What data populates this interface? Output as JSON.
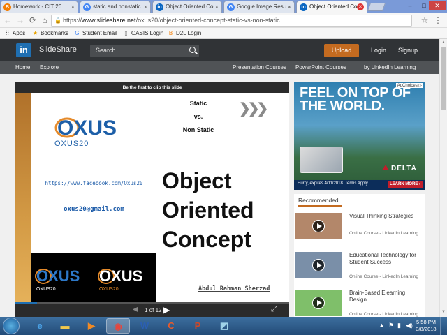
{
  "browser": {
    "tabs": [
      {
        "title": "Homework - CIT 26",
        "icon": "blogger-icon",
        "icon_char": "B",
        "icon_color": "#f57d00",
        "active": false
      },
      {
        "title": "static and nonstatic",
        "icon": "google-icon",
        "icon_char": "G",
        "icon_color": "#4285f4",
        "active": false
      },
      {
        "title": "Object Oriented Co",
        "icon": "linkedin-icon",
        "icon_char": "in",
        "icon_color": "#0a66c2",
        "active": false
      },
      {
        "title": "Google Image Resu",
        "icon": "google-icon",
        "icon_char": "G",
        "icon_color": "#4285f4",
        "active": false
      },
      {
        "title": "Object Oriented Co",
        "icon": "linkedin-icon",
        "icon_char": "in",
        "icon_color": "#0a66c2",
        "active": true
      }
    ],
    "window_controls": {
      "minimize": "–",
      "maximize": "□",
      "close": "✕"
    },
    "nav": {
      "back": "←",
      "forward": "→",
      "reload": "⟳",
      "home": "⌂"
    },
    "url_prefix": "https://",
    "url_host": "www.slideshare.net",
    "url_path": "/oxus20/object-oriented-concept-static-vs-non-static",
    "star": "☆",
    "menu": "⋮",
    "bookmarks": [
      {
        "label": "Apps",
        "icon": "apps-icon",
        "char": "⠿",
        "color": "#555"
      },
      {
        "label": "Bookmarks",
        "icon": "star-icon",
        "char": "★",
        "color": "#e8a400"
      },
      {
        "label": "Student Email",
        "icon": "google-icon",
        "char": "G",
        "color": "#4285f4"
      },
      {
        "label": "OASIS Login",
        "icon": "page-icon",
        "char": "▯",
        "color": "#777"
      },
      {
        "label": "D2L Login",
        "icon": "d2l-icon",
        "char": "B",
        "color": "#f57d00"
      }
    ]
  },
  "slideshare": {
    "logo_in": "in",
    "logo_text": "SlideShare",
    "search_placeholder": "Search",
    "upload": "Upload",
    "login": "Login",
    "signup": "Signup",
    "subnav_left": [
      "Home",
      "Explore"
    ],
    "subnav_right": [
      "Presentation Courses",
      "PowerPoint Courses",
      "by LinkedIn Learning"
    ]
  },
  "player": {
    "clip_text": "Be the first to clip this slide",
    "static_line1": "Static",
    "static_line2": "vs.",
    "static_line3": "Non Static",
    "chevrons": "❯❯❯",
    "brand_main": "OXUS",
    "brand_sub": "OXUS20",
    "facebook": "https://www.facebook.com/Oxus20",
    "email": "oxus20@gmail.com",
    "title_line1": "Object",
    "title_line2": "Oriented",
    "title_line3": "Concept",
    "author": "Abdul Rahman Sherzad",
    "page_current": "1",
    "page_of": "of",
    "page_total": "12",
    "progress_fraction": 0.08,
    "prev": "◀",
    "next": "▶",
    "fullscreen": "⤢"
  },
  "ad": {
    "adchoices": "AdChoices ▷",
    "headline1": "FEEL ON TOP OF",
    "headline2": "THE WORLD.",
    "brand": "DELTA",
    "terms": "Hurry, expires 4/11/2018. Terms Apply.",
    "cta": "LEARN MORE ›"
  },
  "recommended": {
    "title": "Recommended",
    "items": [
      {
        "title": "Visual Thinking Strategies",
        "sub": "Online Course - LinkedIn Learning",
        "thumb_color": "#b3876a"
      },
      {
        "title": "Educational Technology for Student Success",
        "sub": "Online Course - LinkedIn Learning",
        "thumb_color": "#7a8fa8"
      },
      {
        "title": "Brain-Based Elearning Design",
        "sub": "Online Course - LinkedIn Learning",
        "thumb_color": "#7fbf6a"
      }
    ]
  },
  "taskbar": {
    "apps": [
      {
        "name": "ie-icon",
        "char": "e",
        "color": "#4aa3e8"
      },
      {
        "name": "folder-icon",
        "char": "▬",
        "color": "#f2c94c"
      },
      {
        "name": "media-player-icon",
        "char": "▶",
        "color": "#f08a24"
      },
      {
        "name": "chrome-icon",
        "char": "◉",
        "color": "#e8453c"
      },
      {
        "name": "word-icon",
        "char": "W",
        "color": "#2b5fb4"
      },
      {
        "name": "app-c-icon",
        "char": "C",
        "color": "#e85a2a"
      },
      {
        "name": "powerpoint-icon",
        "char": "P",
        "color": "#d24726"
      },
      {
        "name": "tool-icon",
        "char": "◩",
        "color": "#9fd3e8"
      }
    ],
    "time": "5:58 PM",
    "date": "3/8/2018"
  }
}
